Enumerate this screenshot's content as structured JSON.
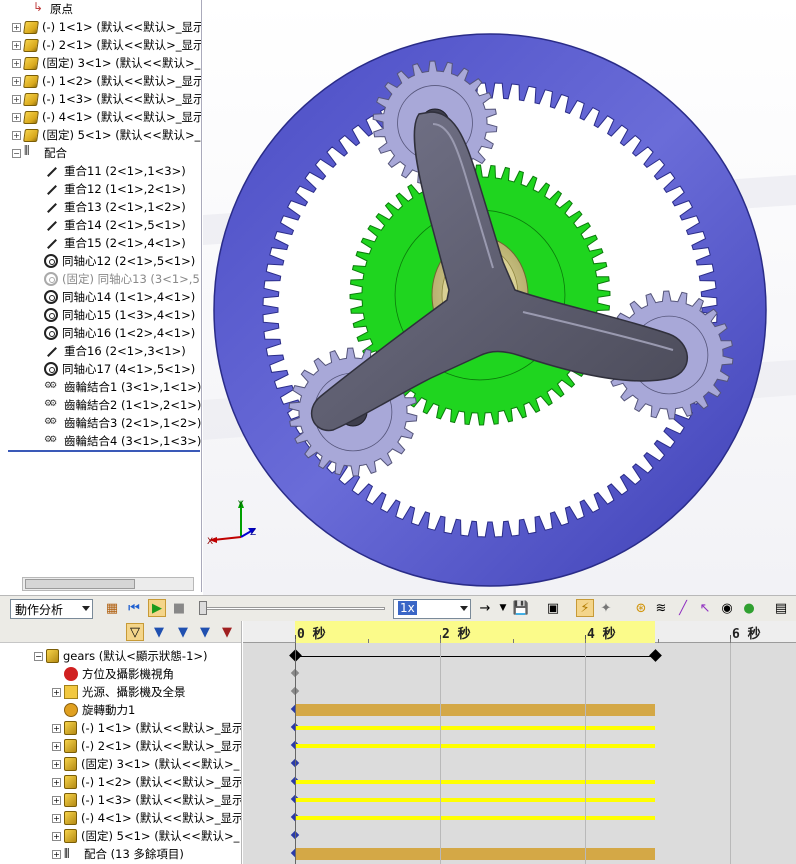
{
  "feature_tree": {
    "items": [
      {
        "label": "原点",
        "icon": "origin-icon"
      },
      {
        "label": "(-) 1<1> (默认<<默认>_显示",
        "icon": "part-icon"
      },
      {
        "label": "(-) 2<1> (默认<<默认>_显示",
        "icon": "part-icon"
      },
      {
        "label": "(固定) 3<1> (默认<<默认>_",
        "icon": "part-icon"
      },
      {
        "label": "(-) 1<2> (默认<<默认>_显示",
        "icon": "part-icon"
      },
      {
        "label": "(-) 1<3> (默认<<默认>_显示",
        "icon": "part-icon"
      },
      {
        "label": "(-) 4<1> (默认<<默认>_显示",
        "icon": "part-icon"
      },
      {
        "label": "(固定) 5<1> (默认<<默认>_",
        "icon": "part-icon"
      },
      {
        "label": "配合",
        "icon": "mates-folder-icon"
      },
      {
        "label": "重合11 (2<1>,1<3>)",
        "icon": "coincident-mate-icon"
      },
      {
        "label": "重合12 (1<1>,2<1>)",
        "icon": "coincident-mate-icon"
      },
      {
        "label": "重合13 (2<1>,1<2>)",
        "icon": "coincident-mate-icon"
      },
      {
        "label": "重合14 (2<1>,5<1>)",
        "icon": "coincident-mate-icon"
      },
      {
        "label": "重合15 (2<1>,4<1>)",
        "icon": "coincident-mate-icon"
      },
      {
        "label": "同轴心12 (2<1>,5<1>)",
        "icon": "concentric-mate-icon"
      },
      {
        "label": "(固定) 同轴心13 (3<1>,5",
        "icon": "concentric-mate-icon"
      },
      {
        "label": "同轴心14 (1<1>,4<1>)",
        "icon": "concentric-mate-icon"
      },
      {
        "label": "同轴心15 (1<3>,4<1>)",
        "icon": "concentric-mate-icon"
      },
      {
        "label": "同轴心16 (1<2>,4<1>)",
        "icon": "concentric-mate-icon"
      },
      {
        "label": "重合16 (2<1>,3<1>)",
        "icon": "coincident-mate-icon"
      },
      {
        "label": "同轴心17 (4<1>,5<1>)",
        "icon": "concentric-mate-icon"
      },
      {
        "label": "齒輪結合1 (3<1>,1<1>)",
        "icon": "gear-mate-icon"
      },
      {
        "label": "齒輪結合2 (1<1>,2<1>)",
        "icon": "gear-mate-icon"
      },
      {
        "label": "齒輪結合3 (2<1>,1<2>)",
        "icon": "gear-mate-icon"
      },
      {
        "label": "齒輪結合4 (3<1>,1<3>)",
        "icon": "gear-mate-icon"
      }
    ]
  },
  "triad": {
    "x": "X",
    "y": "Y",
    "z": "Z"
  },
  "motion_toolbar": {
    "study_type": "動作分析",
    "playback_speed": "1x"
  },
  "motion_tree": {
    "items": [
      {
        "label": "gears (默认<顯示狀態-1>)",
        "icon": "assembly-icon"
      },
      {
        "label": "方位及攝影機視角",
        "icon": "orientation-icon"
      },
      {
        "label": "光源、攝影機及全景",
        "icon": "lights-icon"
      },
      {
        "label": "旋轉動力1",
        "icon": "motor-icon"
      },
      {
        "label": "(-) 1<1> (默认<<默认>_显示",
        "icon": "part-icon"
      },
      {
        "label": "(-) 2<1> (默认<<默认>_显示",
        "icon": "part-icon"
      },
      {
        "label": "(固定) 3<1> (默认<<默认>_",
        "icon": "part-icon"
      },
      {
        "label": "(-) 1<2> (默认<<默认>_显示",
        "icon": "part-icon"
      },
      {
        "label": "(-) 1<3> (默认<<默认>_显示",
        "icon": "part-icon"
      },
      {
        "label": "(-) 4<1> (默认<<默认>_显示",
        "icon": "part-icon"
      },
      {
        "label": "(固定) 5<1> (默认<<默认>_",
        "icon": "part-icon"
      },
      {
        "label": "配合 (13 多餘項目)",
        "icon": "mates-folder-icon"
      }
    ]
  },
  "timeline": {
    "ticks": [
      "0 秒",
      "2 秒",
      "4 秒",
      "6 秒"
    ],
    "rows": [
      "key",
      "none",
      "none",
      "motor",
      "part",
      "part",
      "none",
      "part",
      "part",
      "part",
      "none",
      "mates"
    ],
    "colors": {
      "motor_bar": "#d4a846",
      "part_bar": "#ffff00",
      "header_highlight": "#fbfb8a"
    }
  },
  "colors": {
    "ring_gear": "#5d5fcf",
    "sun_gear": "#1fd51f",
    "planet_gear": "#a8a8d8",
    "carrier": "#5c5c6a"
  }
}
